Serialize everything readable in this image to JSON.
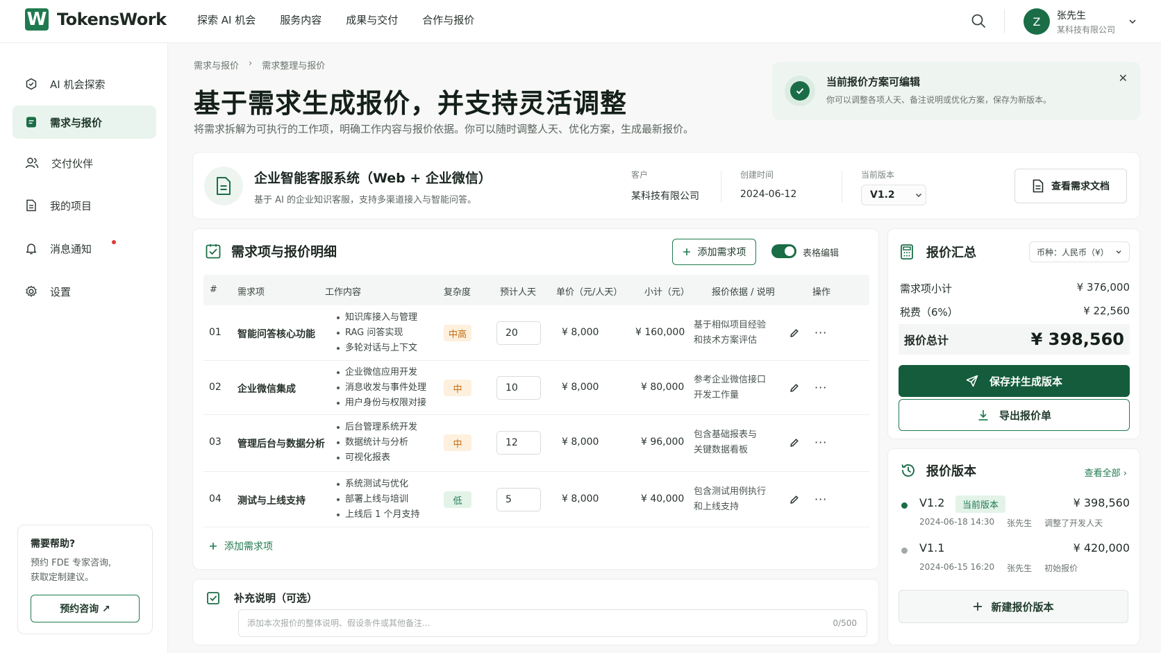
{
  "brand": {
    "logo_letter": "W",
    "name": "TokensWork"
  },
  "topnav": [
    "探索 AI 机会",
    "服务内容",
    "成果与交付",
    "合作与报价"
  ],
  "user": {
    "initial": "Z",
    "name": "张先生",
    "company": "某科技有限公司"
  },
  "sidebar": {
    "items": [
      {
        "label": "AI 机会探索",
        "icon": "compass-icon"
      },
      {
        "label": "需求与报价",
        "icon": "document-icon",
        "active": true
      },
      {
        "label": "交付伙伴",
        "icon": "users-icon"
      },
      {
        "label": "我的项目",
        "icon": "file-icon"
      },
      {
        "label": "消息通知",
        "icon": "bell-icon",
        "badge": true
      },
      {
        "label": "设置",
        "icon": "gear-icon"
      }
    ],
    "help": {
      "title": "需要帮助?",
      "desc_line1": "预约 FDE 专家咨询,",
      "desc_line2": "获取定制建议。",
      "button": "预约咨询 ↗"
    }
  },
  "breadcrumb": [
    "需求与报价",
    "需求整理与报价"
  ],
  "page": {
    "title": "基于需求生成报价，并支持灵活调整",
    "subtitle": "将需求拆解为可执行的工作项，明确工作内容与报价依据。你可以随时调整人天、优化方案，生成最新报价。"
  },
  "toast": {
    "title": "当前报价方案可编辑",
    "desc": "你可以调整各项人天、备注说明或优化方案，保存为新版本。"
  },
  "project": {
    "name": "企业智能客服系统（Web + 企业微信）",
    "desc": "基于 AI 的企业知识客服，支持多渠道接入与智能问答。",
    "client_label": "客户",
    "client": "某科技有限公司",
    "created_label": "创建时间",
    "created": "2024-06-12",
    "version_label": "当前版本",
    "version": "V1.2",
    "doc_button": "查看需求文档"
  },
  "items": {
    "title": "需求项与报价明细",
    "add_button": "添加需求项",
    "toggle_label": "表格编辑",
    "columns": [
      "#",
      "需求项",
      "工作内容",
      "复杂度",
      "预计人天",
      "单价（元/人天）",
      "小计（元）",
      "报价依据 / 说明",
      "操作"
    ],
    "rows": [
      {
        "no": "01",
        "name": "智能问答核心功能",
        "works": [
          "知识库接入与管理",
          "RAG 问答实现",
          "多轮对话与上下文"
        ],
        "complexity": "中高",
        "cx": "hi",
        "days": "20",
        "price": "¥ 8,000",
        "subtotal": "¥ 160,000",
        "note1": "基于相似项目经验",
        "note2": "和技术方案评估"
      },
      {
        "no": "02",
        "name": "企业微信集成",
        "works": [
          "企业微信应用开发",
          "消息收发与事件处理",
          "用户身份与权限对接"
        ],
        "complexity": "中",
        "cx": "mid",
        "days": "10",
        "price": "¥ 8,000",
        "subtotal": "¥ 80,000",
        "note1": "参考企业微信接口",
        "note2": "开发工作量"
      },
      {
        "no": "03",
        "name": "管理后台与数据分析",
        "works": [
          "后台管理系统开发",
          "数据统计与分析",
          "可视化报表"
        ],
        "complexity": "中",
        "cx": "mid",
        "days": "12",
        "price": "¥ 8,000",
        "subtotal": "¥ 96,000",
        "note1": "包含基础报表与",
        "note2": "关键数据看板"
      },
      {
        "no": "04",
        "name": "测试与上线支持",
        "works": [
          "系统测试与优化",
          "部署上线与培训",
          "上线后 1 个月支持"
        ],
        "complexity": "低",
        "cx": "lo",
        "days": "5",
        "price": "¥ 8,000",
        "subtotal": "¥ 40,000",
        "note1": "包含测试用例执行",
        "note2": "和上线支持"
      }
    ],
    "add_row": "添加需求项"
  },
  "supplement": {
    "title": "补充说明（可选）",
    "placeholder": "添加本次报价的整体说明、假设条件或其他备注...",
    "count": "0/500"
  },
  "summary": {
    "title": "报价汇总",
    "currency": "币种：人民币（¥）",
    "subtotal_label": "需求项小计",
    "subtotal": "¥ 376,000",
    "tax_label": "税费（6%）",
    "tax": "¥ 22,560",
    "total_label": "报价总计",
    "total": "¥ 398,560",
    "save_button": "保存并生成版本",
    "export_button": "导出报价单"
  },
  "versions": {
    "title": "报价版本",
    "view_all": "查看全部",
    "list": [
      {
        "name": "V1.2",
        "tag": "当前版本",
        "amount": "¥ 398,560",
        "time": "2024-06-18 14:30",
        "user": "张先生",
        "note": "调整了开发人天",
        "color": "#1a6d47"
      },
      {
        "name": "V1.1",
        "tag": "",
        "amount": "¥ 420,000",
        "time": "2024-06-15 16:20",
        "user": "张先生",
        "note": "初始报价",
        "color": "#a3aaa6"
      }
    ],
    "new_button": "新建报价版本"
  }
}
